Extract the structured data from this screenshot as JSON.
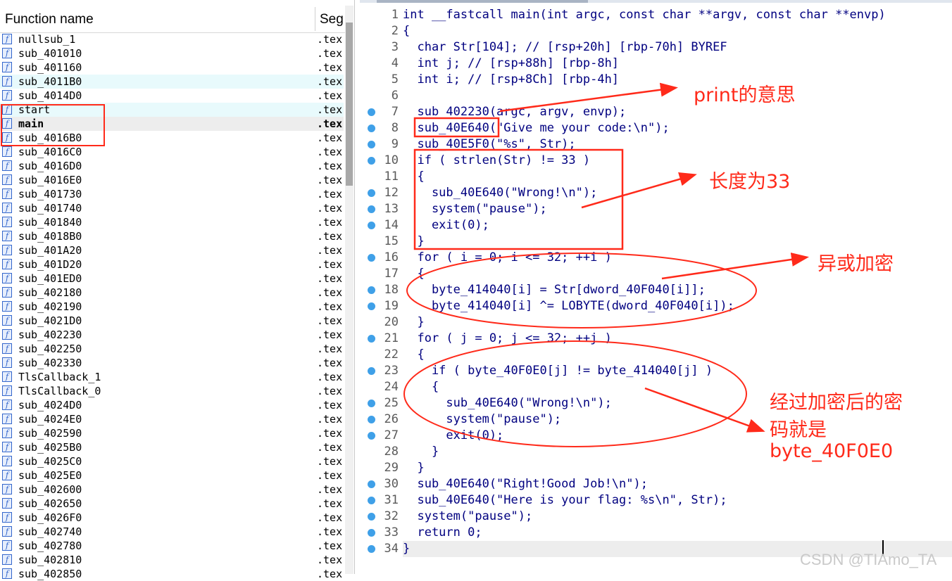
{
  "function_list": {
    "header": {
      "name": "Function name",
      "segment": "Seg"
    },
    "rows": [
      {
        "name": "nullsub_1",
        "seg": ".tex"
      },
      {
        "name": "sub_401010",
        "seg": ".tex"
      },
      {
        "name": "sub_401160",
        "seg": ".tex"
      },
      {
        "name": "sub_4011B0",
        "seg": ".tex"
      },
      {
        "name": "sub_4014D0",
        "seg": ".tex"
      },
      {
        "name": "start",
        "seg": ".tex"
      },
      {
        "name": "main",
        "seg": ".tex"
      },
      {
        "name": "sub_4016B0",
        "seg": ".tex"
      },
      {
        "name": "sub_4016C0",
        "seg": ".tex"
      },
      {
        "name": "sub_4016D0",
        "seg": ".tex"
      },
      {
        "name": "sub_4016E0",
        "seg": ".tex"
      },
      {
        "name": "sub_401730",
        "seg": ".tex"
      },
      {
        "name": "sub_401740",
        "seg": ".tex"
      },
      {
        "name": "sub_401840",
        "seg": ".tex"
      },
      {
        "name": "sub_4018B0",
        "seg": ".tex"
      },
      {
        "name": "sub_401A20",
        "seg": ".tex"
      },
      {
        "name": "sub_401D20",
        "seg": ".tex"
      },
      {
        "name": "sub_401ED0",
        "seg": ".tex"
      },
      {
        "name": "sub_402180",
        "seg": ".tex"
      },
      {
        "name": "sub_402190",
        "seg": ".tex"
      },
      {
        "name": "sub_4021D0",
        "seg": ".tex"
      },
      {
        "name": "sub_402230",
        "seg": ".tex"
      },
      {
        "name": "sub_402250",
        "seg": ".tex"
      },
      {
        "name": "sub_402330",
        "seg": ".tex"
      },
      {
        "name": "TlsCallback_1",
        "seg": ".tex"
      },
      {
        "name": "TlsCallback_0",
        "seg": ".tex"
      },
      {
        "name": "sub_4024D0",
        "seg": ".tex"
      },
      {
        "name": "sub_4024E0",
        "seg": ".tex"
      },
      {
        "name": "sub_402590",
        "seg": ".tex"
      },
      {
        "name": "sub_4025B0",
        "seg": ".tex"
      },
      {
        "name": "sub_4025C0",
        "seg": ".tex"
      },
      {
        "name": "sub_4025E0",
        "seg": ".tex"
      },
      {
        "name": "sub_402600",
        "seg": ".tex"
      },
      {
        "name": "sub_402650",
        "seg": ".tex"
      },
      {
        "name": "sub_4026F0",
        "seg": ".tex"
      },
      {
        "name": "sub_402740",
        "seg": ".tex"
      },
      {
        "name": "sub_402780",
        "seg": ".tex"
      },
      {
        "name": "sub_402810",
        "seg": ".tex"
      },
      {
        "name": "sub_402850",
        "seg": ".tex"
      }
    ],
    "highlighted_rows": [
      "sub_4011B0",
      "start"
    ],
    "selected_row": "main"
  },
  "pseudocode": {
    "lines": [
      {
        "n": "1",
        "bp": false,
        "text": "int __fastcall main(int argc, const char **argv, const char **envp)"
      },
      {
        "n": "2",
        "bp": false,
        "text": "{"
      },
      {
        "n": "3",
        "bp": false,
        "text": "  char Str[104]; // [rsp+20h] [rbp-70h] BYREF"
      },
      {
        "n": "4",
        "bp": false,
        "text": "  int j; // [rsp+88h] [rbp-8h]"
      },
      {
        "n": "5",
        "bp": false,
        "text": "  int i; // [rsp+8Ch] [rbp-4h]"
      },
      {
        "n": "6",
        "bp": false,
        "text": ""
      },
      {
        "n": "7",
        "bp": true,
        "text": "  sub_402230(argc, argv, envp);"
      },
      {
        "n": "8",
        "bp": true,
        "text": "  sub_40E640(\"Give me your code:\\n\");"
      },
      {
        "n": "9",
        "bp": true,
        "text": "  sub_40E5F0(\"%s\", Str);"
      },
      {
        "n": "10",
        "bp": true,
        "text": "  if ( strlen(Str) != 33 )"
      },
      {
        "n": "11",
        "bp": false,
        "text": "  {"
      },
      {
        "n": "12",
        "bp": true,
        "text": "    sub_40E640(\"Wrong!\\n\");"
      },
      {
        "n": "13",
        "bp": true,
        "text": "    system(\"pause\");"
      },
      {
        "n": "14",
        "bp": true,
        "text": "    exit(0);"
      },
      {
        "n": "15",
        "bp": false,
        "text": "  }"
      },
      {
        "n": "16",
        "bp": true,
        "text": "  for ( i = 0; i <= 32; ++i )"
      },
      {
        "n": "17",
        "bp": false,
        "text": "  {"
      },
      {
        "n": "18",
        "bp": true,
        "text": "    byte_414040[i] = Str[dword_40F040[i]];"
      },
      {
        "n": "19",
        "bp": true,
        "text": "    byte_414040[i] ^= LOBYTE(dword_40F040[i]);"
      },
      {
        "n": "20",
        "bp": false,
        "text": "  }"
      },
      {
        "n": "21",
        "bp": true,
        "text": "  for ( j = 0; j <= 32; ++j )"
      },
      {
        "n": "22",
        "bp": false,
        "text": "  {"
      },
      {
        "n": "23",
        "bp": true,
        "text": "    if ( byte_40F0E0[j] != byte_414040[j] )"
      },
      {
        "n": "24",
        "bp": false,
        "text": "    {"
      },
      {
        "n": "25",
        "bp": true,
        "text": "      sub_40E640(\"Wrong!\\n\");"
      },
      {
        "n": "26",
        "bp": true,
        "text": "      system(\"pause\");"
      },
      {
        "n": "27",
        "bp": true,
        "text": "      exit(0);"
      },
      {
        "n": "28",
        "bp": false,
        "text": "    }"
      },
      {
        "n": "29",
        "bp": false,
        "text": "  }"
      },
      {
        "n": "30",
        "bp": true,
        "text": "  sub_40E640(\"Right!Good Job!\\n\");"
      },
      {
        "n": "31",
        "bp": true,
        "text": "  sub_40E640(\"Here is your flag: %s\\n\", Str);"
      },
      {
        "n": "32",
        "bp": true,
        "text": "  system(\"pause\");"
      },
      {
        "n": "33",
        "bp": true,
        "text": "  return 0;"
      },
      {
        "n": "34",
        "bp": true,
        "text": "}"
      }
    ],
    "current_line": "34"
  },
  "annotations": {
    "print_note": "print的意思",
    "length_note": "长度为33",
    "xor_note": "异或加密",
    "result_note_line1": "经过加密后的密",
    "result_note_line2": "码就是",
    "result_note_line3": "byte_40F0E0",
    "color": "#ff2a1a"
  },
  "watermark": "CSDN @TIAmo_TA",
  "colors": {
    "code_text": "#000080",
    "comment": "#6f7fb3",
    "breakpoint": "#3fa0e8",
    "highlight_row": "#e8fafc",
    "current_line": "#ededed"
  }
}
